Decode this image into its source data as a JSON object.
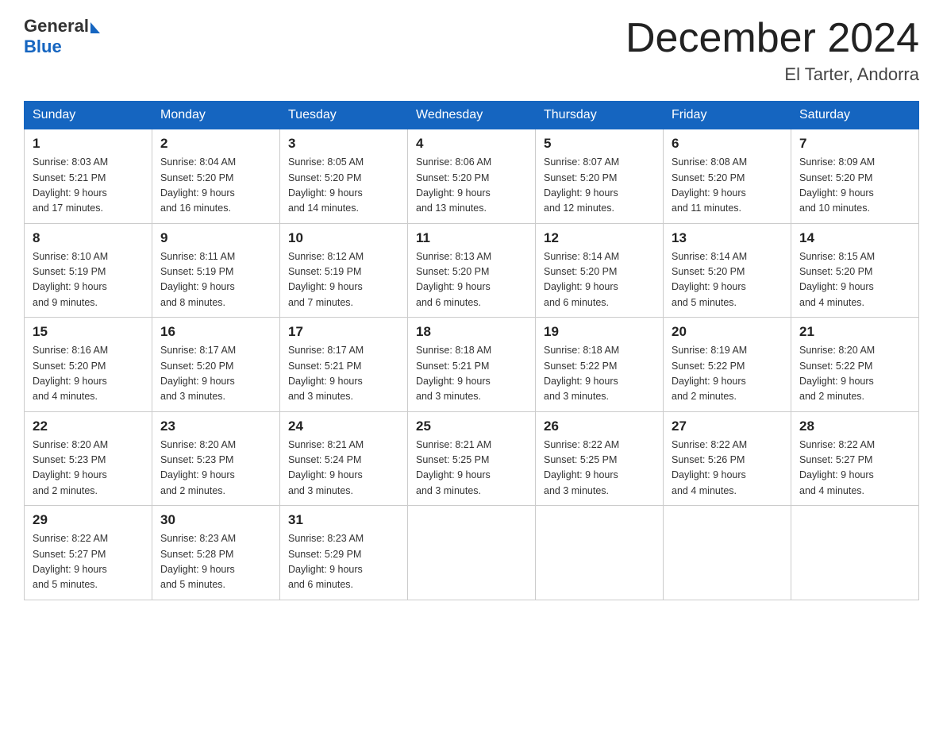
{
  "header": {
    "logo_general": "General",
    "logo_blue": "Blue",
    "month_title": "December 2024",
    "location": "El Tarter, Andorra"
  },
  "weekdays": [
    "Sunday",
    "Monday",
    "Tuesday",
    "Wednesday",
    "Thursday",
    "Friday",
    "Saturday"
  ],
  "weeks": [
    [
      {
        "day": "1",
        "sunrise": "8:03 AM",
        "sunset": "5:21 PM",
        "daylight": "9 hours and 17 minutes."
      },
      {
        "day": "2",
        "sunrise": "8:04 AM",
        "sunset": "5:20 PM",
        "daylight": "9 hours and 16 minutes."
      },
      {
        "day": "3",
        "sunrise": "8:05 AM",
        "sunset": "5:20 PM",
        "daylight": "9 hours and 14 minutes."
      },
      {
        "day": "4",
        "sunrise": "8:06 AM",
        "sunset": "5:20 PM",
        "daylight": "9 hours and 13 minutes."
      },
      {
        "day": "5",
        "sunrise": "8:07 AM",
        "sunset": "5:20 PM",
        "daylight": "9 hours and 12 minutes."
      },
      {
        "day": "6",
        "sunrise": "8:08 AM",
        "sunset": "5:20 PM",
        "daylight": "9 hours and 11 minutes."
      },
      {
        "day": "7",
        "sunrise": "8:09 AM",
        "sunset": "5:20 PM",
        "daylight": "9 hours and 10 minutes."
      }
    ],
    [
      {
        "day": "8",
        "sunrise": "8:10 AM",
        "sunset": "5:19 PM",
        "daylight": "9 hours and 9 minutes."
      },
      {
        "day": "9",
        "sunrise": "8:11 AM",
        "sunset": "5:19 PM",
        "daylight": "9 hours and 8 minutes."
      },
      {
        "day": "10",
        "sunrise": "8:12 AM",
        "sunset": "5:19 PM",
        "daylight": "9 hours and 7 minutes."
      },
      {
        "day": "11",
        "sunrise": "8:13 AM",
        "sunset": "5:20 PM",
        "daylight": "9 hours and 6 minutes."
      },
      {
        "day": "12",
        "sunrise": "8:14 AM",
        "sunset": "5:20 PM",
        "daylight": "9 hours and 6 minutes."
      },
      {
        "day": "13",
        "sunrise": "8:14 AM",
        "sunset": "5:20 PM",
        "daylight": "9 hours and 5 minutes."
      },
      {
        "day": "14",
        "sunrise": "8:15 AM",
        "sunset": "5:20 PM",
        "daylight": "9 hours and 4 minutes."
      }
    ],
    [
      {
        "day": "15",
        "sunrise": "8:16 AM",
        "sunset": "5:20 PM",
        "daylight": "9 hours and 4 minutes."
      },
      {
        "day": "16",
        "sunrise": "8:17 AM",
        "sunset": "5:20 PM",
        "daylight": "9 hours and 3 minutes."
      },
      {
        "day": "17",
        "sunrise": "8:17 AM",
        "sunset": "5:21 PM",
        "daylight": "9 hours and 3 minutes."
      },
      {
        "day": "18",
        "sunrise": "8:18 AM",
        "sunset": "5:21 PM",
        "daylight": "9 hours and 3 minutes."
      },
      {
        "day": "19",
        "sunrise": "8:18 AM",
        "sunset": "5:22 PM",
        "daylight": "9 hours and 3 minutes."
      },
      {
        "day": "20",
        "sunrise": "8:19 AM",
        "sunset": "5:22 PM",
        "daylight": "9 hours and 2 minutes."
      },
      {
        "day": "21",
        "sunrise": "8:20 AM",
        "sunset": "5:22 PM",
        "daylight": "9 hours and 2 minutes."
      }
    ],
    [
      {
        "day": "22",
        "sunrise": "8:20 AM",
        "sunset": "5:23 PM",
        "daylight": "9 hours and 2 minutes."
      },
      {
        "day": "23",
        "sunrise": "8:20 AM",
        "sunset": "5:23 PM",
        "daylight": "9 hours and 2 minutes."
      },
      {
        "day": "24",
        "sunrise": "8:21 AM",
        "sunset": "5:24 PM",
        "daylight": "9 hours and 3 minutes."
      },
      {
        "day": "25",
        "sunrise": "8:21 AM",
        "sunset": "5:25 PM",
        "daylight": "9 hours and 3 minutes."
      },
      {
        "day": "26",
        "sunrise": "8:22 AM",
        "sunset": "5:25 PM",
        "daylight": "9 hours and 3 minutes."
      },
      {
        "day": "27",
        "sunrise": "8:22 AM",
        "sunset": "5:26 PM",
        "daylight": "9 hours and 4 minutes."
      },
      {
        "day": "28",
        "sunrise": "8:22 AM",
        "sunset": "5:27 PM",
        "daylight": "9 hours and 4 minutes."
      }
    ],
    [
      {
        "day": "29",
        "sunrise": "8:22 AM",
        "sunset": "5:27 PM",
        "daylight": "9 hours and 5 minutes."
      },
      {
        "day": "30",
        "sunrise": "8:23 AM",
        "sunset": "5:28 PM",
        "daylight": "9 hours and 5 minutes."
      },
      {
        "day": "31",
        "sunrise": "8:23 AM",
        "sunset": "5:29 PM",
        "daylight": "9 hours and 6 minutes."
      },
      null,
      null,
      null,
      null
    ]
  ]
}
